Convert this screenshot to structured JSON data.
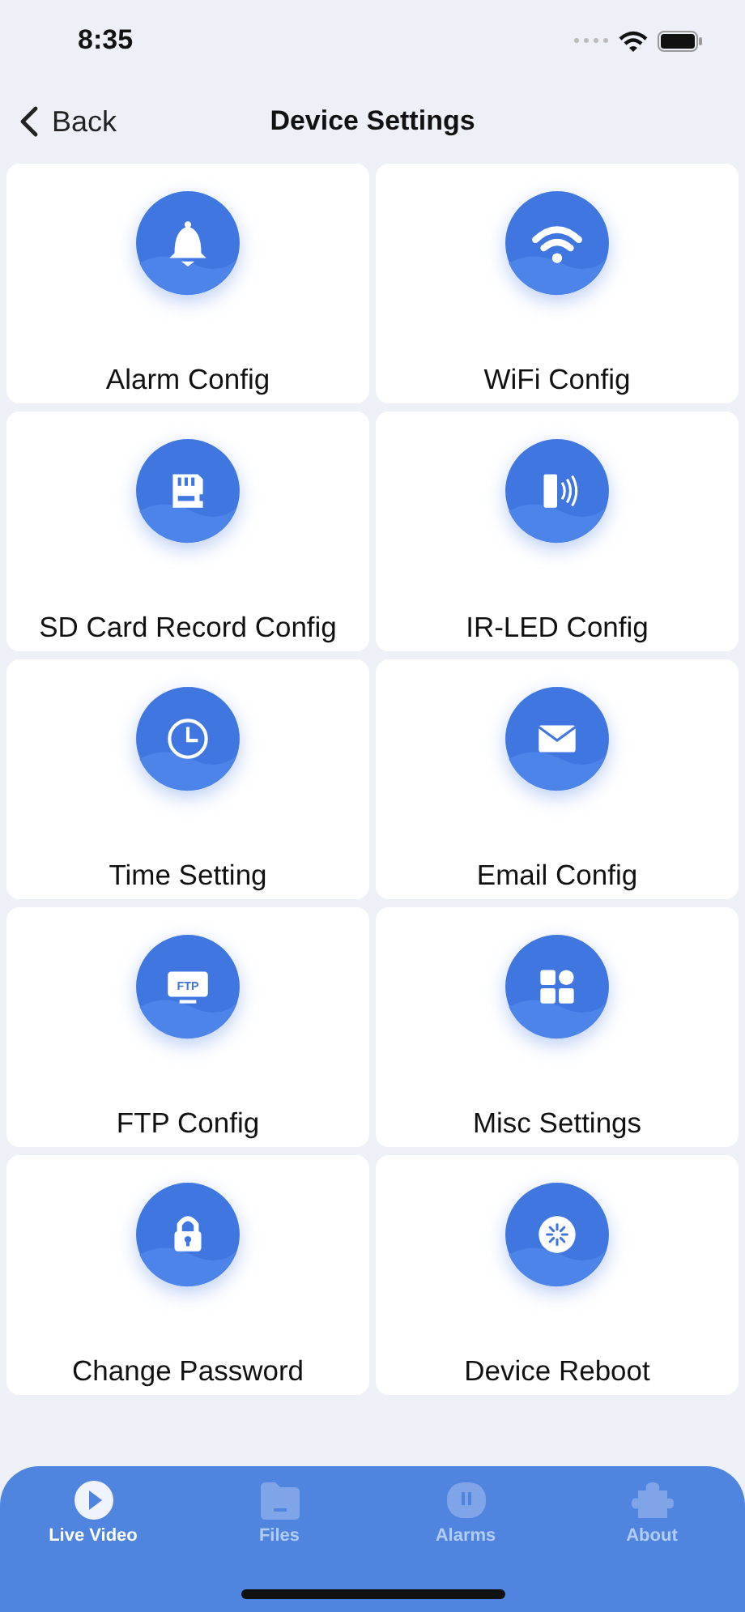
{
  "status_bar": {
    "time": "8:35"
  },
  "nav": {
    "back": "Back",
    "title": "Device Settings"
  },
  "settings": [
    {
      "label": "Alarm Config",
      "kind": "bell"
    },
    {
      "label": "WiFi Config",
      "kind": "wifi"
    },
    {
      "label": "SD Card Record Config",
      "kind": "sdcard"
    },
    {
      "label": "IR-LED Config",
      "kind": "irled"
    },
    {
      "label": "Time Setting",
      "kind": "clock"
    },
    {
      "label": "Email Config",
      "kind": "mail"
    },
    {
      "label": "FTP Config",
      "kind": "ftp",
      "icon_text": "FTP"
    },
    {
      "label": "Misc Settings",
      "kind": "grid"
    },
    {
      "label": "Change Password",
      "kind": "lock"
    },
    {
      "label": "Device Reboot",
      "kind": "reboot"
    }
  ],
  "tabs": [
    {
      "label": "Live Video",
      "kind": "play",
      "selected": true
    },
    {
      "label": "Files",
      "kind": "folder",
      "selected": false
    },
    {
      "label": "Alarms",
      "kind": "alarm",
      "selected": false
    },
    {
      "label": "About",
      "kind": "puzzle",
      "selected": false
    }
  ]
}
